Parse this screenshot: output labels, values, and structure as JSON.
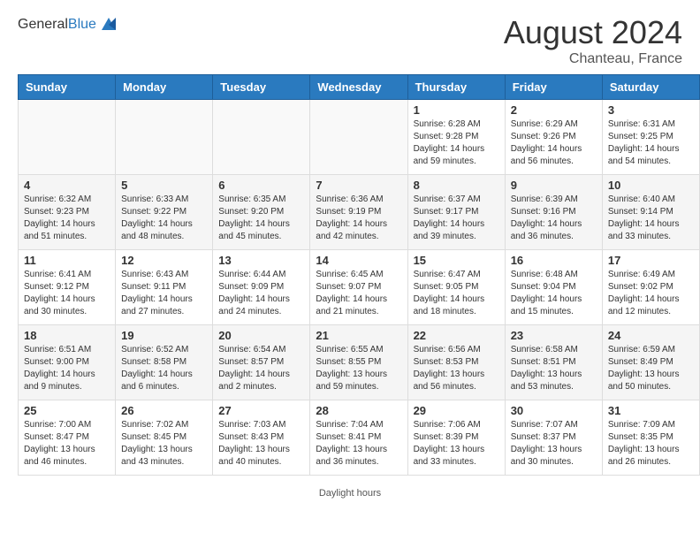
{
  "header": {
    "logo_general": "General",
    "logo_blue": "Blue",
    "month_year": "August 2024",
    "location": "Chanteau, France"
  },
  "days_of_week": [
    "Sunday",
    "Monday",
    "Tuesday",
    "Wednesday",
    "Thursday",
    "Friday",
    "Saturday"
  ],
  "weeks": [
    [
      {
        "day": "",
        "info": ""
      },
      {
        "day": "",
        "info": ""
      },
      {
        "day": "",
        "info": ""
      },
      {
        "day": "",
        "info": ""
      },
      {
        "day": "1",
        "info": "Sunrise: 6:28 AM\nSunset: 9:28 PM\nDaylight: 14 hours\nand 59 minutes."
      },
      {
        "day": "2",
        "info": "Sunrise: 6:29 AM\nSunset: 9:26 PM\nDaylight: 14 hours\nand 56 minutes."
      },
      {
        "day": "3",
        "info": "Sunrise: 6:31 AM\nSunset: 9:25 PM\nDaylight: 14 hours\nand 54 minutes."
      }
    ],
    [
      {
        "day": "4",
        "info": "Sunrise: 6:32 AM\nSunset: 9:23 PM\nDaylight: 14 hours\nand 51 minutes."
      },
      {
        "day": "5",
        "info": "Sunrise: 6:33 AM\nSunset: 9:22 PM\nDaylight: 14 hours\nand 48 minutes."
      },
      {
        "day": "6",
        "info": "Sunrise: 6:35 AM\nSunset: 9:20 PM\nDaylight: 14 hours\nand 45 minutes."
      },
      {
        "day": "7",
        "info": "Sunrise: 6:36 AM\nSunset: 9:19 PM\nDaylight: 14 hours\nand 42 minutes."
      },
      {
        "day": "8",
        "info": "Sunrise: 6:37 AM\nSunset: 9:17 PM\nDaylight: 14 hours\nand 39 minutes."
      },
      {
        "day": "9",
        "info": "Sunrise: 6:39 AM\nSunset: 9:16 PM\nDaylight: 14 hours\nand 36 minutes."
      },
      {
        "day": "10",
        "info": "Sunrise: 6:40 AM\nSunset: 9:14 PM\nDaylight: 14 hours\nand 33 minutes."
      }
    ],
    [
      {
        "day": "11",
        "info": "Sunrise: 6:41 AM\nSunset: 9:12 PM\nDaylight: 14 hours\nand 30 minutes."
      },
      {
        "day": "12",
        "info": "Sunrise: 6:43 AM\nSunset: 9:11 PM\nDaylight: 14 hours\nand 27 minutes."
      },
      {
        "day": "13",
        "info": "Sunrise: 6:44 AM\nSunset: 9:09 PM\nDaylight: 14 hours\nand 24 minutes."
      },
      {
        "day": "14",
        "info": "Sunrise: 6:45 AM\nSunset: 9:07 PM\nDaylight: 14 hours\nand 21 minutes."
      },
      {
        "day": "15",
        "info": "Sunrise: 6:47 AM\nSunset: 9:05 PM\nDaylight: 14 hours\nand 18 minutes."
      },
      {
        "day": "16",
        "info": "Sunrise: 6:48 AM\nSunset: 9:04 PM\nDaylight: 14 hours\nand 15 minutes."
      },
      {
        "day": "17",
        "info": "Sunrise: 6:49 AM\nSunset: 9:02 PM\nDaylight: 14 hours\nand 12 minutes."
      }
    ],
    [
      {
        "day": "18",
        "info": "Sunrise: 6:51 AM\nSunset: 9:00 PM\nDaylight: 14 hours\nand 9 minutes."
      },
      {
        "day": "19",
        "info": "Sunrise: 6:52 AM\nSunset: 8:58 PM\nDaylight: 14 hours\nand 6 minutes."
      },
      {
        "day": "20",
        "info": "Sunrise: 6:54 AM\nSunset: 8:57 PM\nDaylight: 14 hours\nand 2 minutes."
      },
      {
        "day": "21",
        "info": "Sunrise: 6:55 AM\nSunset: 8:55 PM\nDaylight: 13 hours\nand 59 minutes."
      },
      {
        "day": "22",
        "info": "Sunrise: 6:56 AM\nSunset: 8:53 PM\nDaylight: 13 hours\nand 56 minutes."
      },
      {
        "day": "23",
        "info": "Sunrise: 6:58 AM\nSunset: 8:51 PM\nDaylight: 13 hours\nand 53 minutes."
      },
      {
        "day": "24",
        "info": "Sunrise: 6:59 AM\nSunset: 8:49 PM\nDaylight: 13 hours\nand 50 minutes."
      }
    ],
    [
      {
        "day": "25",
        "info": "Sunrise: 7:00 AM\nSunset: 8:47 PM\nDaylight: 13 hours\nand 46 minutes."
      },
      {
        "day": "26",
        "info": "Sunrise: 7:02 AM\nSunset: 8:45 PM\nDaylight: 13 hours\nand 43 minutes."
      },
      {
        "day": "27",
        "info": "Sunrise: 7:03 AM\nSunset: 8:43 PM\nDaylight: 13 hours\nand 40 minutes."
      },
      {
        "day": "28",
        "info": "Sunrise: 7:04 AM\nSunset: 8:41 PM\nDaylight: 13 hours\nand 36 minutes."
      },
      {
        "day": "29",
        "info": "Sunrise: 7:06 AM\nSunset: 8:39 PM\nDaylight: 13 hours\nand 33 minutes."
      },
      {
        "day": "30",
        "info": "Sunrise: 7:07 AM\nSunset: 8:37 PM\nDaylight: 13 hours\nand 30 minutes."
      },
      {
        "day": "31",
        "info": "Sunrise: 7:09 AM\nSunset: 8:35 PM\nDaylight: 13 hours\nand 26 minutes."
      }
    ]
  ],
  "footer": {
    "daylight_label": "Daylight hours"
  }
}
